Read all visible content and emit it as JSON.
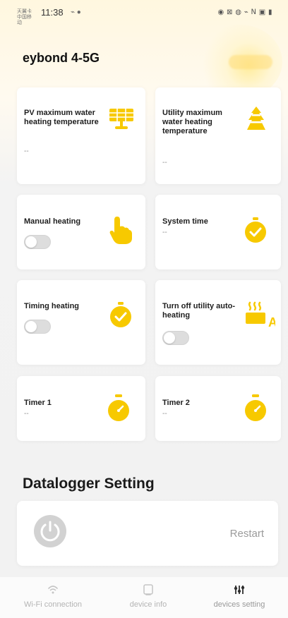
{
  "status_bar": {
    "carrier_text": "天翼卡 中国移动",
    "time": "11:38",
    "small_icons": "⌁ ●",
    "right_icons": "◉ ⊠ ◍ ⌁ 𝖭 ▣ ▮"
  },
  "page": {
    "device_name": "eybond 4-5G"
  },
  "cards": [
    {
      "title": "PV maximum water heating temperature",
      "value": "--"
    },
    {
      "title": "Utility maximum water heating temperature",
      "value": "--"
    },
    {
      "title": "Manual heating",
      "toggle_on": false
    },
    {
      "title": "System time",
      "value": "--"
    },
    {
      "title": "Timing heating",
      "toggle_on": false
    },
    {
      "title": "Turn off utility auto-heating",
      "toggle_on": false
    },
    {
      "title": "Timer 1",
      "value": "--"
    },
    {
      "title": "Timer 2",
      "value": "--"
    }
  ],
  "datalogger": {
    "section_title": "Datalogger Setting",
    "restart_label": "Restart"
  },
  "tabs": [
    {
      "label": "Wi-Fi connection"
    },
    {
      "label": "device info"
    },
    {
      "label": "devices setting"
    }
  ],
  "colors": {
    "accent": "#F7C900",
    "accent_light": "#FFE58A",
    "text_muted": "#9B9B9B"
  }
}
